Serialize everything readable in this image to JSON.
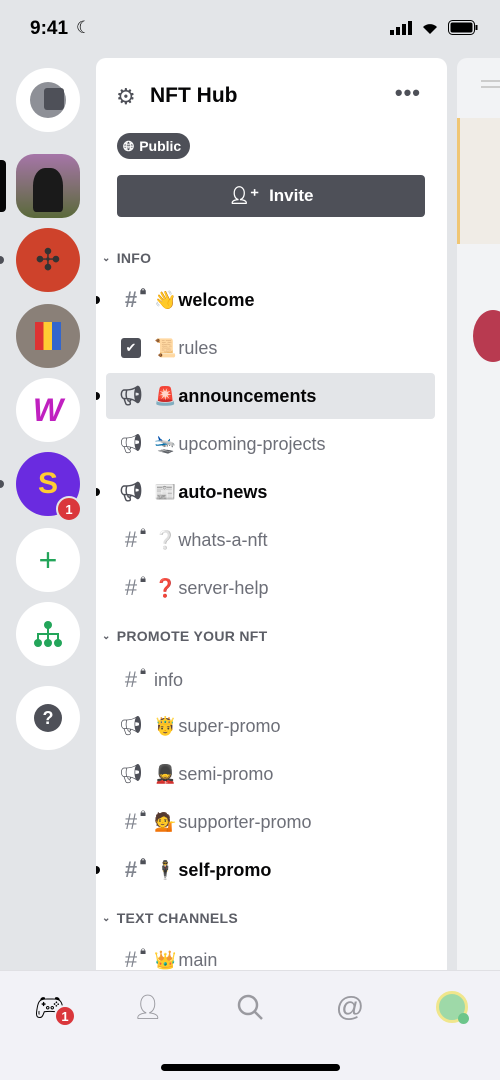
{
  "status_bar": {
    "time": "9:41"
  },
  "server_list": {
    "unread_badge": "1"
  },
  "guild": {
    "name": "NFT Hub",
    "visibility": "Public",
    "invite_label": "Invite",
    "menu_icon": "more-icon"
  },
  "categories": [
    {
      "name": "INFO",
      "channels": [
        {
          "name": "welcome",
          "emoji": "👋",
          "type": "text-locked",
          "unread": true
        },
        {
          "name": "rules",
          "emoji": "📜",
          "type": "rules",
          "unread": false
        },
        {
          "name": "announcements",
          "emoji": "🚨",
          "type": "announcement-locked",
          "unread": true,
          "selected": true
        },
        {
          "name": "upcoming-projects",
          "emoji": "🛬",
          "type": "announcement-locked",
          "unread": false
        },
        {
          "name": "auto-news",
          "emoji": "📰",
          "type": "announcement-locked",
          "unread": true
        },
        {
          "name": "whats-a-nft",
          "emoji": "❔",
          "type": "text-locked",
          "unread": false
        },
        {
          "name": "server-help",
          "emoji": "❓",
          "type": "text-locked",
          "unread": false
        }
      ]
    },
    {
      "name": "PROMOTE YOUR NFT",
      "channels": [
        {
          "name": "info",
          "emoji": "",
          "type": "text-locked",
          "unread": false
        },
        {
          "name": "super-promo",
          "emoji": "🤴",
          "type": "announcement-locked",
          "unread": false
        },
        {
          "name": "semi-promo",
          "emoji": "💂",
          "type": "announcement-locked",
          "unread": false
        },
        {
          "name": "supporter-promo",
          "emoji": "💁",
          "type": "text-locked",
          "unread": false
        },
        {
          "name": "self-promo",
          "emoji": "🕴",
          "type": "text-locked",
          "unread": true
        }
      ]
    },
    {
      "name": "TEXT CHANNELS",
      "channels": [
        {
          "name": "main",
          "emoji": "👑",
          "type": "text-locked",
          "unread": false
        }
      ]
    }
  ],
  "tab_bar": {
    "home_badge": "1",
    "tabs": [
      "home",
      "friends",
      "search",
      "mentions",
      "profile"
    ]
  },
  "colors": {
    "accent": "#4e5058",
    "badge": "#da373c",
    "add": "#23a55a"
  }
}
